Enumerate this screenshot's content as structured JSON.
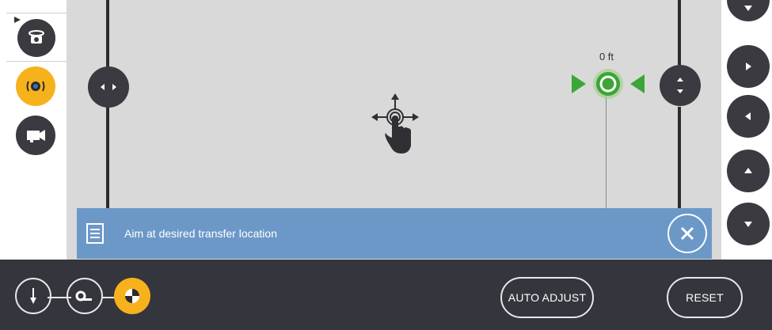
{
  "left_toolbar": {
    "tools": [
      {
        "name": "rotate-camera-icon"
      },
      {
        "name": "aim-target-icon",
        "active": true
      },
      {
        "name": "video-camera-icon"
      }
    ]
  },
  "viewport": {
    "distance_label": "0 ft",
    "gesture_hint_icon": "pan-gesture-icon"
  },
  "banner": {
    "message": "Aim at desired transfer location",
    "close_icon": "close-icon"
  },
  "right_toolbar": {
    "buttons": [
      "down-arrow-top",
      "right-arrow",
      "left-arrow",
      "up-arrow",
      "down-arrow"
    ]
  },
  "bottom_bar": {
    "auto_adjust_label": "AUTO ADJUST",
    "reset_label": "RESET"
  },
  "colors": {
    "accent": "#f6b21c",
    "dark": "#3a3a40",
    "banner": "#6c98c8",
    "target_green": "#3aa635"
  }
}
